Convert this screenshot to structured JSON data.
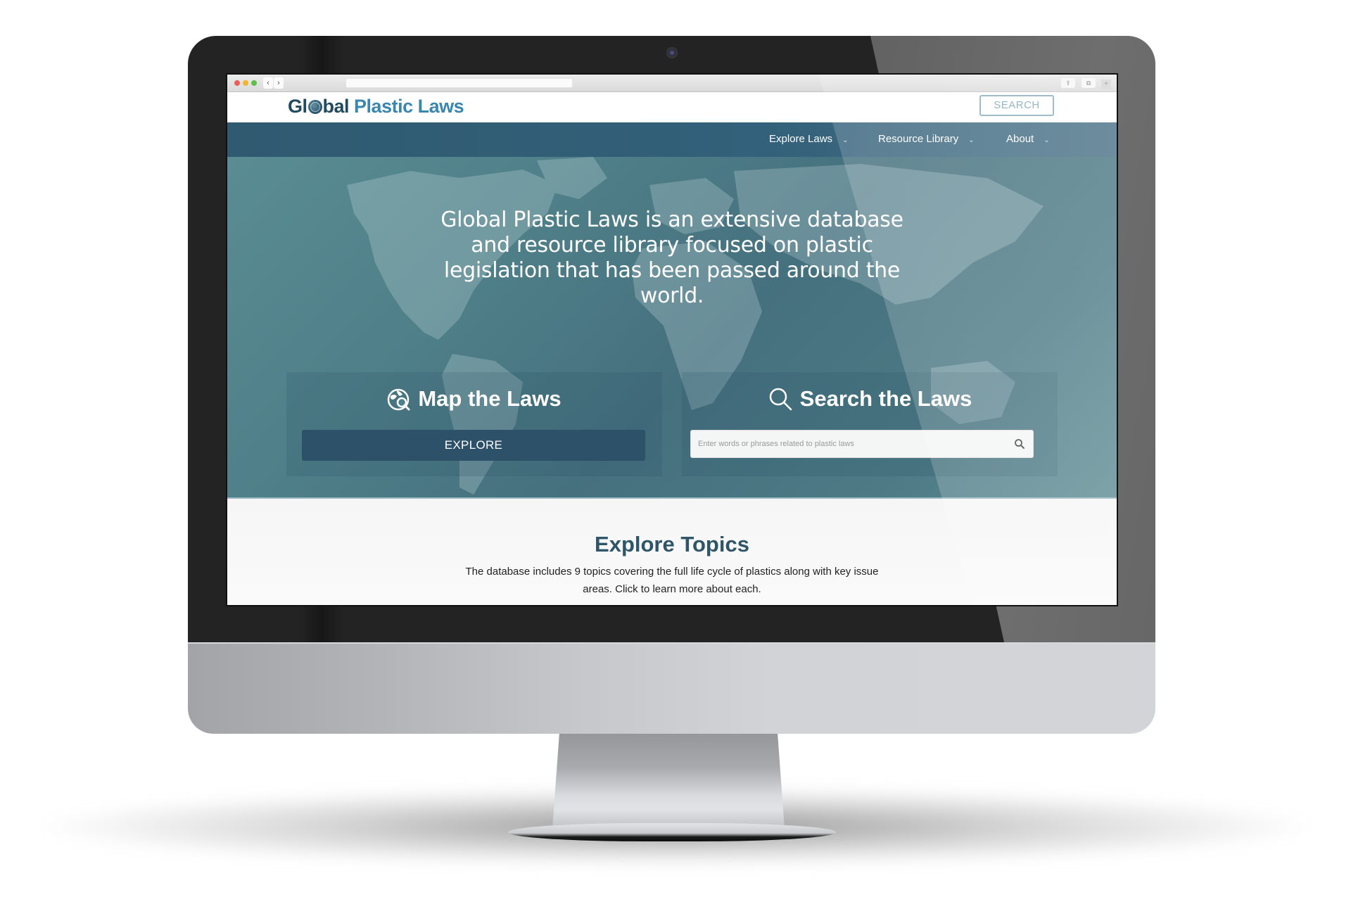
{
  "browser": {
    "nav_back": "‹",
    "nav_forward": "›",
    "share_icon": "⇪",
    "tabs_icon": "⧉",
    "new_tab_icon": "+"
  },
  "header": {
    "logo_part1": "Gl",
    "logo_part2": "bal",
    "logo_part3": "Plastic Laws",
    "search_button": "SEARCH"
  },
  "nav": {
    "items": [
      {
        "label": "Explore Laws",
        "icon": "chevron-down-icon"
      },
      {
        "label": "Resource Library",
        "icon": "chevron-down-icon"
      },
      {
        "label": "About",
        "icon": "chevron-down-icon"
      }
    ],
    "chevron": "⌄"
  },
  "hero": {
    "description": "Global Plastic Laws is an extensive database and resource library focused on plastic legislation that has been passed around the world.",
    "map_panel": {
      "title": "Map the Laws",
      "icon": "globe-search-icon",
      "button": "EXPLORE"
    },
    "search_panel": {
      "title": "Search the Laws",
      "icon": "search-icon",
      "placeholder": "Enter words or phrases related to plastic laws",
      "value": ""
    }
  },
  "topics": {
    "title": "Explore Topics",
    "description": "The database includes 9 topics covering the full life cycle of plastics along with key issue areas. Click to learn more about each."
  },
  "colors": {
    "brand_dark": "#1f4a5f",
    "brand_light": "#3a87ae",
    "nav_bg": "#2f5a70",
    "hero_bg": "#4f7f88",
    "button_bg": "#2c5169",
    "topics_title": "#2e5568"
  }
}
